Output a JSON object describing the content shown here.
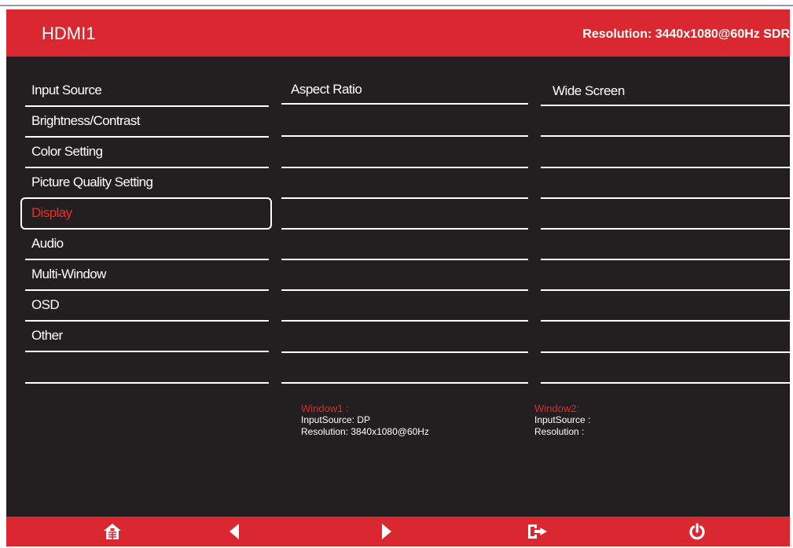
{
  "header": {
    "input_source": "HDMI1",
    "resolution": "Resolution: 3440x1080@60Hz SDR"
  },
  "menu": {
    "items": [
      {
        "label": "Input Source"
      },
      {
        "label": "Brightness/Contrast"
      },
      {
        "label": "Color Setting"
      },
      {
        "label": "Picture Quality Setting"
      },
      {
        "label": "Display",
        "selected": true
      },
      {
        "label": "Audio"
      },
      {
        "label": "Multi-Window"
      },
      {
        "label": "OSD"
      },
      {
        "label": "Other"
      }
    ]
  },
  "submenu": {
    "title": "Aspect Ratio"
  },
  "options": {
    "value": "Wide Screen"
  },
  "window1": {
    "title": "Window1 :",
    "input_source": "InputSource: DP",
    "resolution": "Resolution: 3840x1080@60Hz"
  },
  "window2": {
    "title": "Window2:",
    "input_source": "InputSource :",
    "resolution": "Resolution :"
  },
  "footer": {
    "buttons": [
      "home-icon",
      "left-arrow-icon",
      "right-arrow-icon",
      "exit-icon",
      "power-icon"
    ]
  },
  "colors": {
    "accent_red": "#d9282f",
    "background": "#231f20",
    "selected_text": "#ee2a24",
    "text": "#ffffff"
  }
}
